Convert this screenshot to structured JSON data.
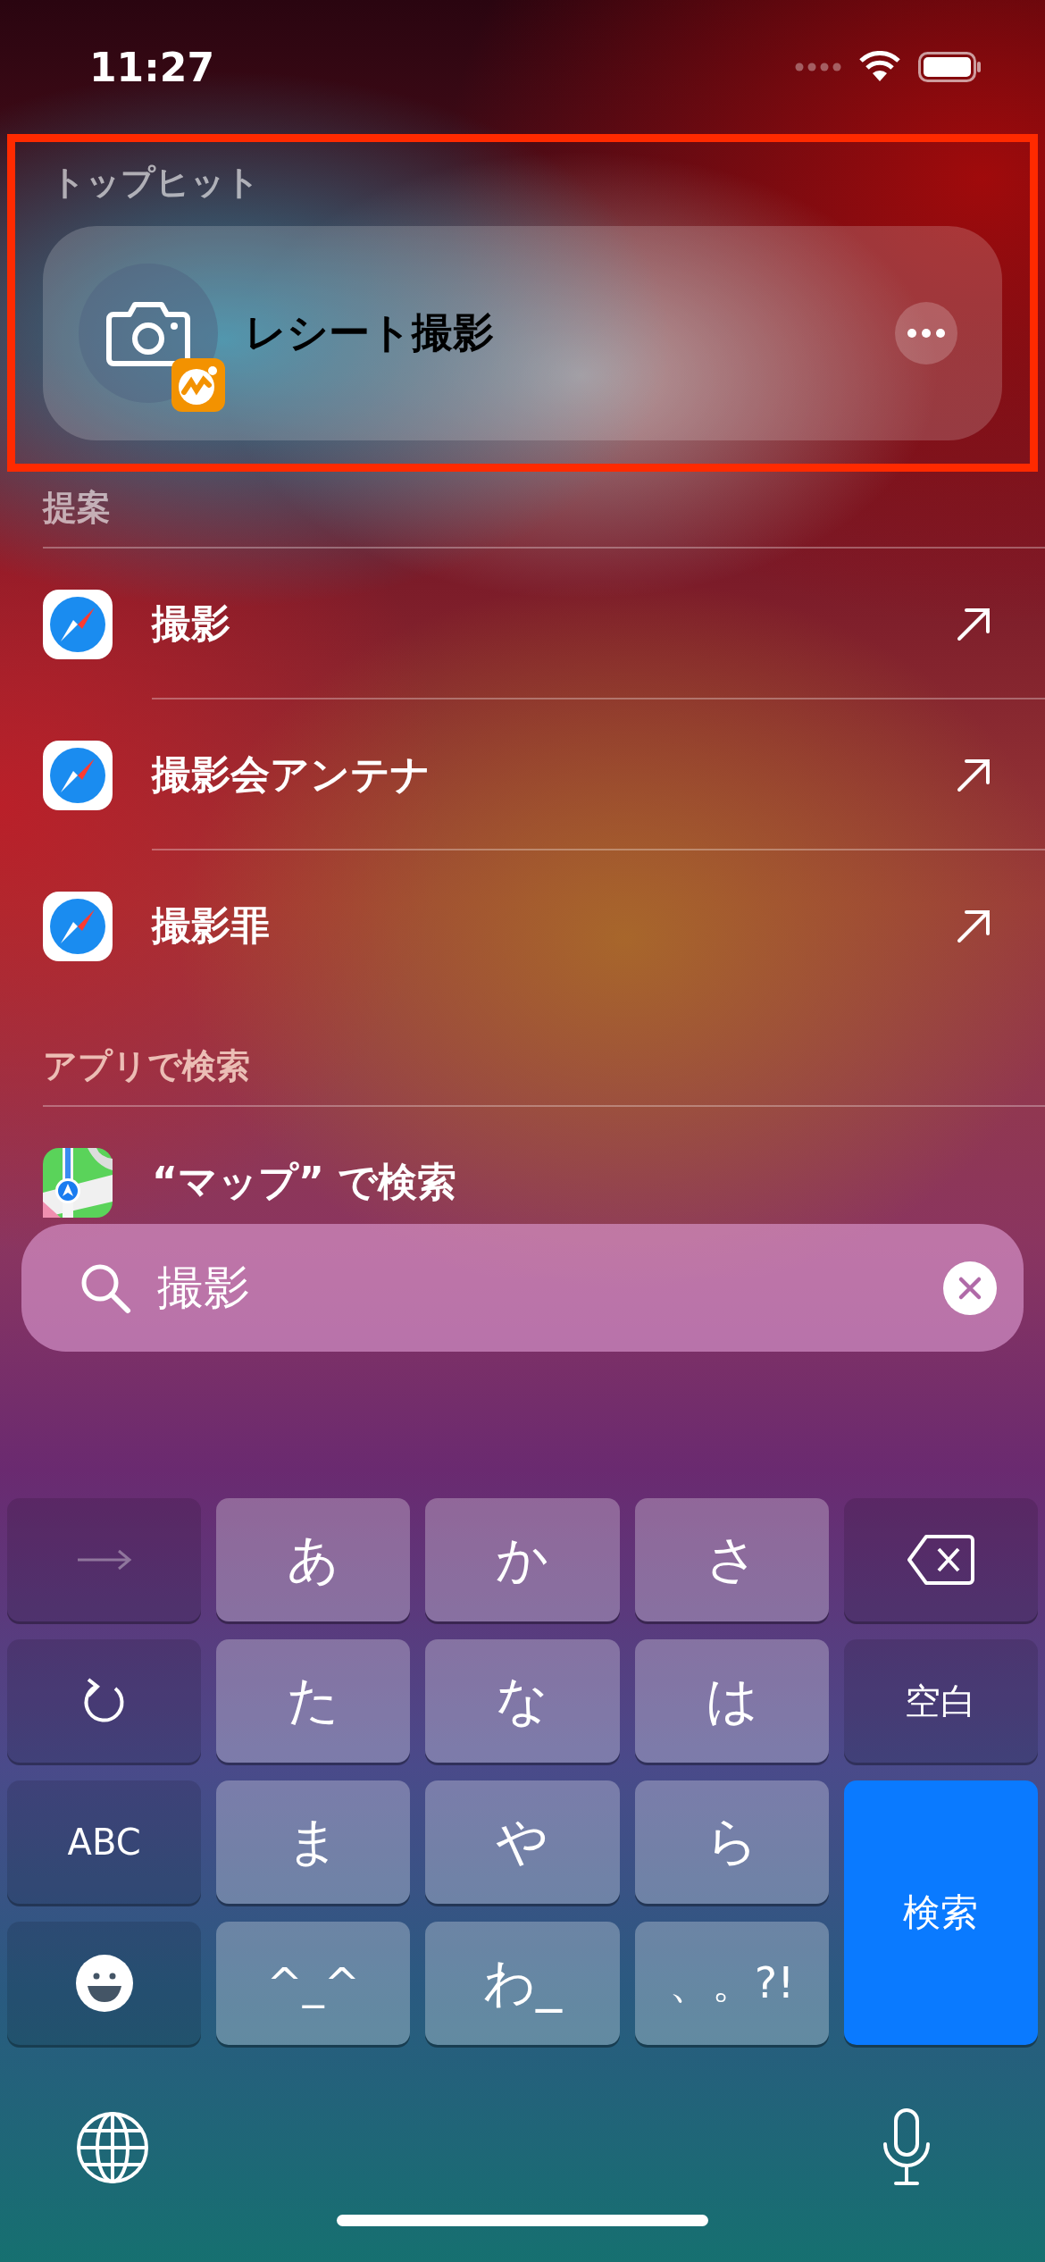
{
  "status_bar": {
    "time": "11:27"
  },
  "top_hit": {
    "header": "トップヒット",
    "title": "レシート撮影",
    "highlighted": true
  },
  "suggestions": {
    "header": "提案",
    "items": [
      {
        "text": "撮影"
      },
      {
        "text": "撮影会アンテナ"
      },
      {
        "text": "撮影罪"
      }
    ]
  },
  "search_in_apps": {
    "header": "アプリで検索",
    "items": [
      {
        "text": "“マップ” で検索"
      }
    ]
  },
  "search_field": {
    "value": "撮影"
  },
  "keyboard": {
    "keys": [
      {
        "kind": "next",
        "disabled": true
      },
      {
        "kind": "char",
        "label": "あ"
      },
      {
        "kind": "char",
        "label": "か"
      },
      {
        "kind": "char",
        "label": "さ"
      },
      {
        "kind": "delete"
      },
      {
        "kind": "undo"
      },
      {
        "kind": "char",
        "label": "た"
      },
      {
        "kind": "char",
        "label": "な"
      },
      {
        "kind": "char",
        "label": "は"
      },
      {
        "kind": "func",
        "label": "空白"
      },
      {
        "kind": "func",
        "label": "ABC"
      },
      {
        "kind": "char",
        "label": "ま"
      },
      {
        "kind": "char",
        "label": "や"
      },
      {
        "kind": "char",
        "label": "ら"
      },
      {
        "kind": "primary",
        "label": "検索"
      },
      {
        "kind": "emoji"
      },
      {
        "kind": "char",
        "label": "^_^"
      },
      {
        "kind": "char",
        "label": "わ_"
      },
      {
        "kind": "char",
        "label": "、。?!"
      }
    ]
  }
}
